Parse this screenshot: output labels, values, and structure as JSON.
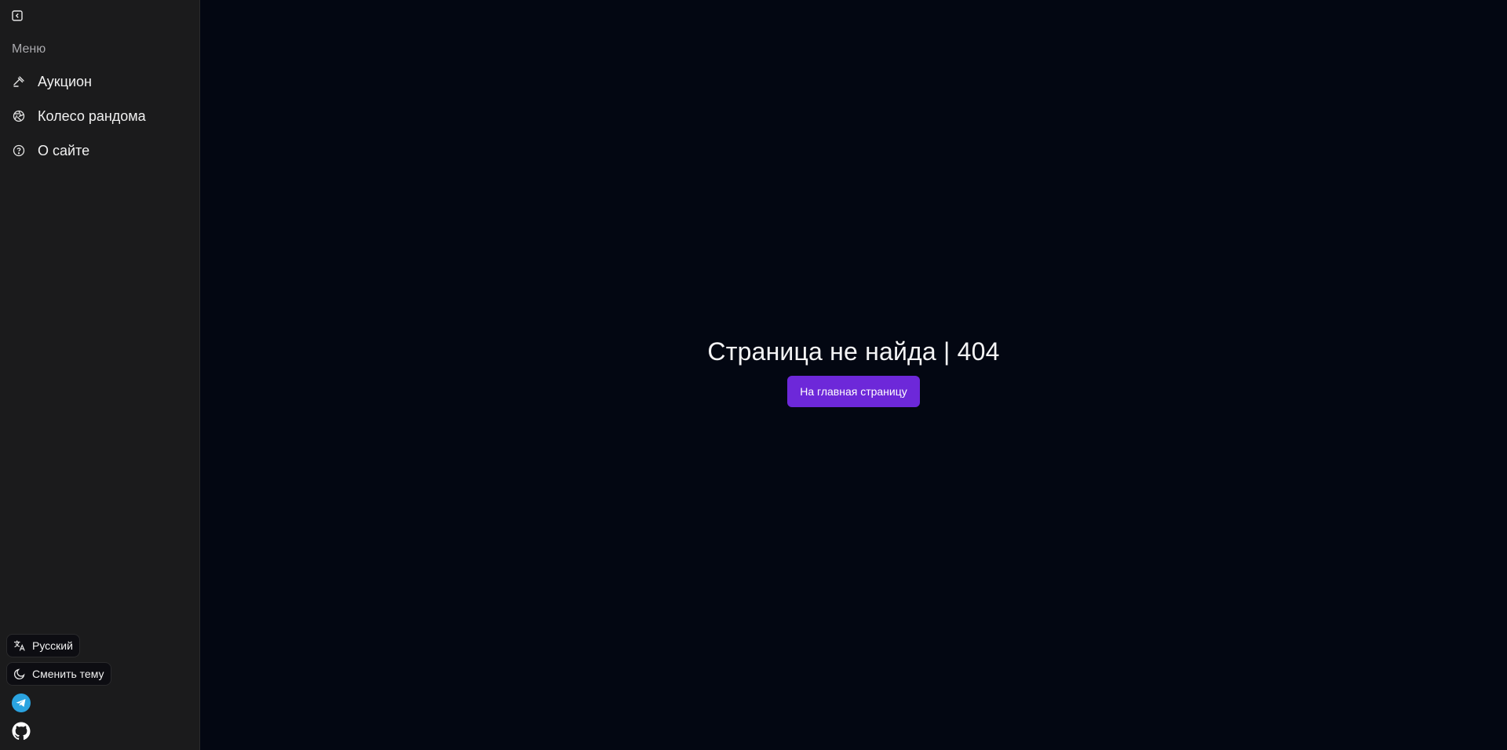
{
  "sidebar": {
    "collapse_icon": "collapse-left-icon",
    "menu_heading": "Меню",
    "items": [
      {
        "label": "Аукцион",
        "icon": "gavel-icon"
      },
      {
        "label": "Колесо рандома",
        "icon": "aperture-icon"
      },
      {
        "label": "О сайте",
        "icon": "help-circle-icon"
      }
    ],
    "language_label": "Русский",
    "theme_label": "Сменить тему",
    "social": [
      "telegram-icon",
      "github-icon"
    ]
  },
  "main": {
    "title": "Страница не найда | 404",
    "home_button_label": "На главная страницу"
  },
  "colors": {
    "background": "#030712",
    "sidebar_bg": "#1b1b1c",
    "accent": "#6d28d9",
    "telegram": "#2aa3e0"
  }
}
